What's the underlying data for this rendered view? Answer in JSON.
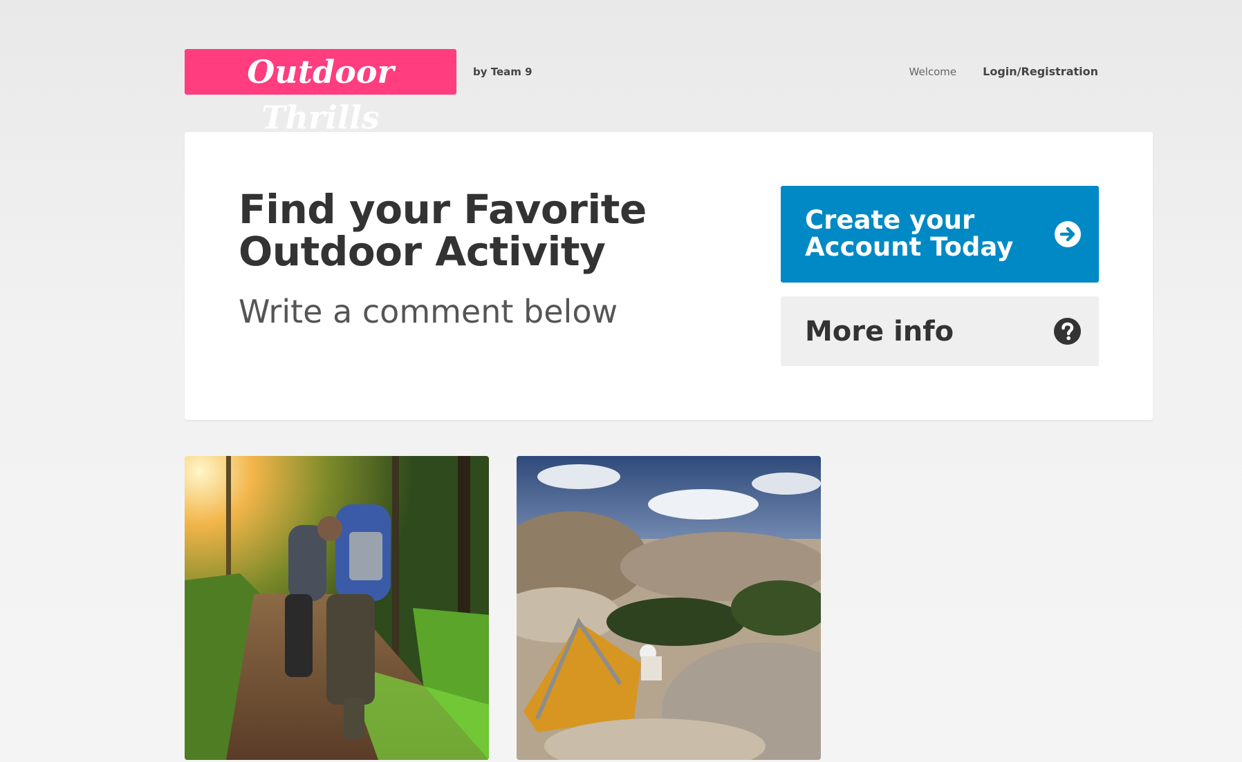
{
  "header": {
    "logo_text": "Outdoor Thrills",
    "byline": "by Team 9",
    "nav": {
      "welcome": "Welcome",
      "login": "Login/Registration"
    }
  },
  "hero": {
    "title": "Find your Favorite Outdoor Activity",
    "subtitle": "Write a comment below",
    "create_button": {
      "label": "Create your Account Today",
      "icon": "arrow-right-circle-icon"
    },
    "more_button": {
      "label": "More info",
      "icon": "question-circle-icon"
    }
  },
  "gallery": [
    {
      "subject": "hikers-with-backpacks-on-forest-trail"
    },
    {
      "subject": "tent-among-desert-boulders"
    }
  ],
  "colors": {
    "brand_pink": "#ff3d7f",
    "primary_blue": "#0089c5",
    "text_dark": "#333333",
    "secondary_button_bg": "#efefef"
  }
}
